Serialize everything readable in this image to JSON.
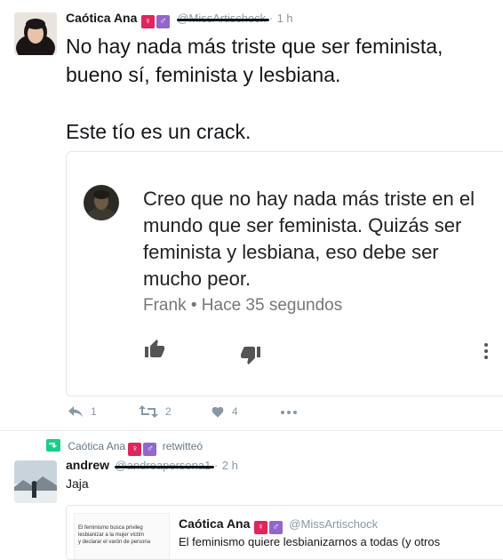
{
  "tweet": {
    "author_name": "Caótica Ana",
    "handle": "@MissArtischock",
    "time": "1 h",
    "text_line1": "No hay nada más triste que ser feminista,",
    "text_line2": "bueno sí, feminista y lesbiana.",
    "text_line3": "Este tío es un crack.",
    "badges": [
      "♀",
      "♂"
    ],
    "colors": {
      "venus": "#e0245e",
      "mars": "#9266cc"
    },
    "embedded": {
      "text_lines": [
        "Creo que no hay nada más triste en el",
        "mundo que ser feminista. Quizás ser",
        "feminista y lesbiana, eso debe ser",
        "mucho peor."
      ],
      "footer": "Frank • Hace 35 segundos",
      "icons": [
        "thumbs-up-icon",
        "thumbs-down-icon",
        "more-vertical-icon"
      ]
    },
    "actions": {
      "reply": "1",
      "retweet": "2",
      "like": "4"
    }
  },
  "retweet_header": {
    "name": "Caótica Ana",
    "label": "retwitteó",
    "icon": "retweet-icon"
  },
  "reply_tweet": {
    "author_name": "andrew",
    "handle": "@andreapersona1",
    "time": "2 h",
    "text": "Jaja",
    "quote": {
      "thumb_text_line1": "El feminismo busca privileg",
      "thumb_text_line2": "lesbianizar a la mujer víctim",
      "thumb_text_line3": "y declarar el varón de persona",
      "author_name": "Caótica Ana",
      "handle": "@MissArtischock",
      "text": "El feminismo quiere lesbianizarnos a todas (y otros"
    }
  }
}
